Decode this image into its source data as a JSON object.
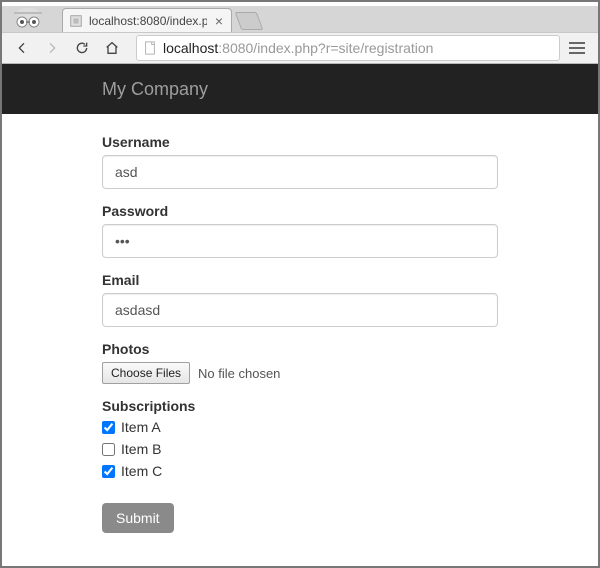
{
  "browser": {
    "tab_title": "localhost:8080/index.p",
    "url_host": "localhost",
    "url_rest": ":8080/index.php?r=site/registration"
  },
  "navbar": {
    "brand": "My Company"
  },
  "form": {
    "username": {
      "label": "Username",
      "value": "asd"
    },
    "password": {
      "label": "Password",
      "value": "•••"
    },
    "email": {
      "label": "Email",
      "value": "asdasd"
    },
    "photos": {
      "label": "Photos",
      "button": "Choose Files",
      "status": "No file chosen"
    },
    "subscriptions": {
      "label": "Subscriptions",
      "items": [
        {
          "label": "Item A",
          "checked": true
        },
        {
          "label": "Item B",
          "checked": false
        },
        {
          "label": "Item C",
          "checked": true
        }
      ]
    },
    "submit": "Submit"
  }
}
